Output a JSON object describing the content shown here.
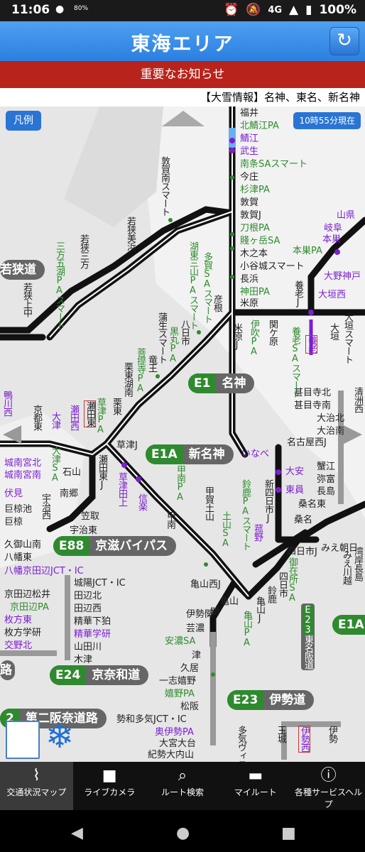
{
  "status_bar": {
    "time": "11:06",
    "battery": "100%",
    "network": "4G",
    "data_small": "80%"
  },
  "header": {
    "title": "東海エリア",
    "refresh_icon": "refresh-icon"
  },
  "notice": {
    "label": "重要なお知らせ"
  },
  "ticker": {
    "text": "【大雪情報】名神、東名、新名神"
  },
  "map": {
    "legend_label": "凡例",
    "timestamp": "10時55分現在",
    "route_badges": [
      {
        "code": "E1",
        "name": "名神"
      },
      {
        "code": "E1A",
        "name": "新名神"
      },
      {
        "code": "E88",
        "name": "京滋バイパス"
      },
      {
        "code": "E24",
        "name": "京奈和道"
      },
      {
        "code": "E23",
        "name": "伊勢道"
      },
      {
        "code": "E1A",
        "name": ""
      },
      {
        "code": "E23",
        "name": "東名阪道"
      },
      {
        "code": "",
        "name": "若狭道"
      },
      {
        "code": "2",
        "name": "第二阪奈道路"
      },
      {
        "code": "",
        "name": "路"
      }
    ],
    "labels": {
      "fukui": "福井",
      "kitasabae": "北鯖江PA",
      "sabae": "鯖江",
      "takefu": "武生",
      "nanjo": "南条SAスマート",
      "imajo": "今庄",
      "sugitsu": "杉津PA",
      "tsuruga": "敦賀",
      "tsurugaj": "敦賀J",
      "tohara": "刀根PA",
      "shizugatake": "賤ヶ岳SA",
      "kinomoto": "木之本",
      "kotanijo": "小谷城スマート",
      "nagahama": "長浜",
      "kanda": "神田PA",
      "maibara": "米原",
      "maibaraj": "米原J",
      "hikone": "彦根",
      "taga": "多賀SAスマート",
      "konan_mikumo": "湖東三山PAスマート",
      "yokaichi": "八日市",
      "kuromaru": "黒丸PA",
      "gamo": "蒲生スマート",
      "ryuo": "竜王",
      "bodaiji": "菩提寺PA",
      "ritto": "栗東湖南",
      "ritto2": "栗東",
      "kusatsu": "草津PA",
      "kusatsuj": "草津J",
      "seta_higashi": "瀬田東",
      "setaj": "瀬田東J",
      "kusatsu_tagami": "草津田上",
      "shigaraki": "信楽",
      "konan": "甲南PA",
      "koka_tsuchiyama": "甲賀土山",
      "tsuchiyama": "土山SA",
      "konan2": "甲南",
      "suzuka": "鈴鹿PAスマート",
      "kameyama_nishi": "亀山西J",
      "kameyama": "亀山J",
      "kameyama_pa": "亀山PA",
      "kameyama_seki": "亀山",
      "seki": "関",
      "iseseki": "伊勢関",
      "geino": "芸濃",
      "ano": "安濃SA",
      "tsu": "津",
      "hisai": "久居",
      "ichishi": "一志嬉野",
      "ureshino": "嬉野PA",
      "matsusaka": "松阪",
      "seiwa_taki": "勢和多気JCT・IC",
      "okuise": "奥伊勢PA",
      "odai": "大宮大台",
      "kii_onouchi": "紀勢大内山",
      "taki": "多気ヴィスマート",
      "tamaki": "玉城",
      "ise_nishi": "伊勢西",
      "ise": "伊勢",
      "inabe": "いなべ",
      "daian": "大安",
      "toin": "東員",
      "shin_yokkaichi": "新四日市J",
      "komono": "菰野",
      "yokkaichi_higashi": "四日市J",
      "gozaisho": "御在所SA",
      "yokkaichi": "四日市",
      "suzuka2": "鈴鹿",
      "mie_asahi": "みえ朝日",
      "wangan_nagashima": "湾岸長島",
      "miekawagoe": "みえ川越",
      "nagoya_nishi": "名古屋西J",
      "kuwana": "桑名",
      "kuwana_higashi": "桑名東",
      "nagashima": "長島",
      "yatomi": "弥富",
      "kanie": "蟹江",
      "ohhata": "大治南",
      "oharu": "大治北",
      "kanie2": "甚目寺南",
      "jimokuji": "甚目寺北",
      "kiyosu": "清洲西",
      "kiyosu_higashi": "清洲東",
      "yoro": "養老",
      "yoro_j": "養老J",
      "yoro_sa": "養老SAスマート",
      "sekigahara": "関ケ原",
      "ibuki": "伊吹PA",
      "ogaki_nishi": "大垣西",
      "ono_kobe": "大野神戸",
      "motosu": "本巣",
      "motosu_pa": "本巣PA",
      "yamagata": "山県",
      "gifu": "岐阜",
      "ogaki": "大垣",
      "ogaki_smart": "大垣スマート",
      "tsuruga_minami": "敦賀南スマート",
      "wakasa_mihama": "若狭美浜",
      "wakasa_mikata": "若狭三方",
      "mikatagoko": "三方五湖PAスマート",
      "wakasa_kaminaka": "若狭上中",
      "kyoto_higashi": "京都東",
      "kamogawa": "鴨川西",
      "ohtsu": "大津",
      "ohtsu_sa": "大津SA",
      "setanishi": "瀬田西",
      "ishiyama": "石山",
      "nango": "南郷",
      "kasatori": "笠取",
      "ujihigashi": "宇治東",
      "uji_nishi": "宇治西",
      "kumiyama": "久御山南",
      "yawata": "八幡東",
      "yawata_jct": "八幡京田辺JCT・IC",
      "kyotanabe": "京田辺松井",
      "kyotanabe_pa": "京田辺PA",
      "hirakata": "枚方東",
      "hirakata_gaku": "枚方学研",
      "katano": "交野北",
      "jonan": "城南宮北",
      "jonan2": "城南宮南",
      "fushimi": "伏見",
      "kumiike": "巨椋池",
      "ogura": "巨椋",
      "ujinishi2": "宇治西",
      "joyo": "城陽JCT・IC",
      "tanabe_kita": "田辺北",
      "tanabe_nishi": "田辺西",
      "seika": "精華下狛",
      "seika_gaku": "精華学研",
      "yamadagawa": "山田川",
      "kizu": "木津"
    }
  },
  "bottom_nav": [
    {
      "label": "交通状況マップ",
      "icon": "japan-map-icon"
    },
    {
      "label": "ライブカメラ",
      "icon": "camera-icon"
    },
    {
      "label": "ルート検索",
      "icon": "search-icon"
    },
    {
      "label": "マイルート",
      "icon": "car-icon"
    },
    {
      "label": "各種サービスヘルプ",
      "icon": "info-icon"
    }
  ],
  "colors": {
    "header_blue": "#2b7fe0",
    "notice_red": "#b8231b",
    "route_green": "#2f8a2f",
    "ic_purple": "#7b1fd0"
  }
}
